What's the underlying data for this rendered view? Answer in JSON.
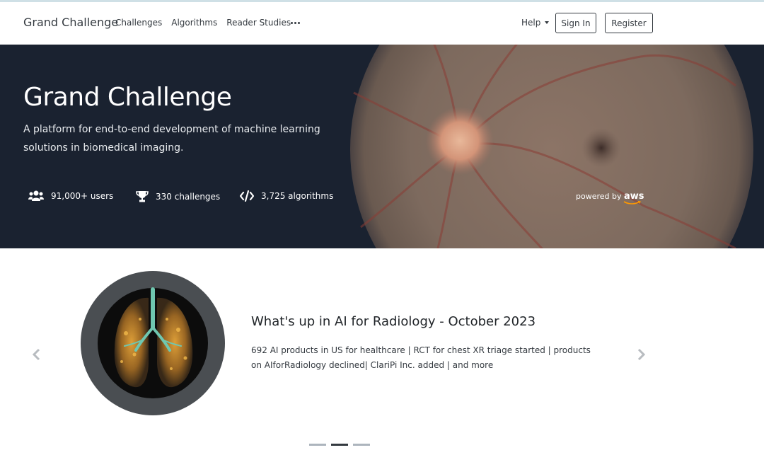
{
  "navbar": {
    "brand": "Grand Challenge",
    "links": [
      "Challenges",
      "Algorithms",
      "Reader Studies"
    ],
    "more_icon": "ellipsis-icon",
    "help": "Help",
    "sign_in": "Sign In",
    "register": "Register"
  },
  "hero": {
    "title": "Grand Challenge",
    "subtitle": "A platform for end-to-end development of machine learning solutions in biomedical imaging.",
    "stats": [
      {
        "icon": "users-icon",
        "label": "91,000+ users"
      },
      {
        "icon": "trophy-icon",
        "label": "330 challenges"
      },
      {
        "icon": "code-icon",
        "label": "3,725 algorithms"
      }
    ],
    "powered_by": "powered by",
    "powered_logo": "aws",
    "background_image": "retina-fundus-image",
    "background_color": "#1a2230"
  },
  "carousel": {
    "slide_title": "What's up in AI for Radiology - October 2023",
    "slide_text": "692 AI products in US for healthcare | RCT for chest XR triage started | products on AIforRadiology declined| ClariPi Inc. added | and more",
    "slide_image": "lungs-scan-image",
    "prev_icon": "chevron-left-icon",
    "next_icon": "chevron-right-icon",
    "slide_count": 3,
    "active_slide": 2
  },
  "colors": {
    "accent": "#cfe0e6",
    "text_dark": "#343a40",
    "indicator_active": "#343a40",
    "indicator_inactive": "#adb5bd",
    "lung_highlight": "#e8a63a"
  }
}
